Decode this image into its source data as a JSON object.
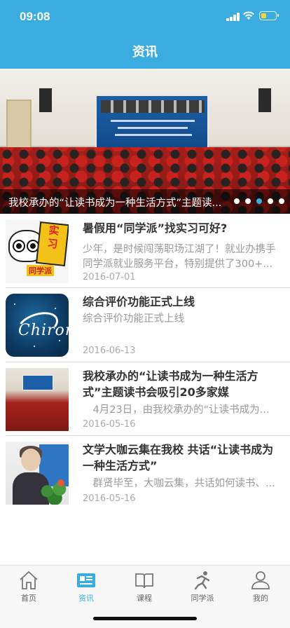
{
  "status_bar": {
    "time": "09:08"
  },
  "header": {
    "title": "资讯"
  },
  "banner": {
    "caption": "我校承办的“让读书成为一种生活方式”主题读...",
    "dot_count": 5,
    "active_dot": 3
  },
  "news": [
    {
      "title": "暑假用“同学派”找实习可好?",
      "summary": "少年，是时候闯荡职场江湖了！就业办携手同学派就业服务平台，特别提供了300+...",
      "date": "2016-07-01",
      "thumb_icon": "intern-mascot-image",
      "thumb_text": [
        "实",
        "习"
      ],
      "thumb_label": "同学派"
    },
    {
      "title": "综合评价功能正式上线",
      "summary": "综合评价功能正式上线",
      "date": "2016-06-13",
      "thumb_icon": "chiron-logo-image",
      "thumb_text": "Chiron"
    },
    {
      "title": "我校承办的“让读书成为一种生活方式”主题读书会吸引20多家媒",
      "summary": "　4月23日，由我校承办的“让读书成为...",
      "date": "2016-05-16",
      "thumb_icon": "reading-event-photo"
    },
    {
      "title": "文学大咖云集在我校 共话“让读书成为一种生活方式”",
      "summary": "　群贤毕至，大咖云集，共话如何读书、...",
      "date": "2016-05-16",
      "thumb_icon": "speaker-photo"
    }
  ],
  "tabbar": {
    "items": [
      {
        "label": "首页",
        "icon": "home-icon",
        "active": false
      },
      {
        "label": "资讯",
        "icon": "news-icon",
        "active": true
      },
      {
        "label": "课程",
        "icon": "book-icon",
        "active": false
      },
      {
        "label": "同学派",
        "icon": "runner-icon",
        "active": false
      },
      {
        "label": "我的",
        "icon": "profile-icon",
        "active": false
      }
    ]
  },
  "colors": {
    "accent": "#3aace0",
    "tab_inactive": "#666666",
    "text_primary": "#333333",
    "text_secondary": "#999999"
  }
}
